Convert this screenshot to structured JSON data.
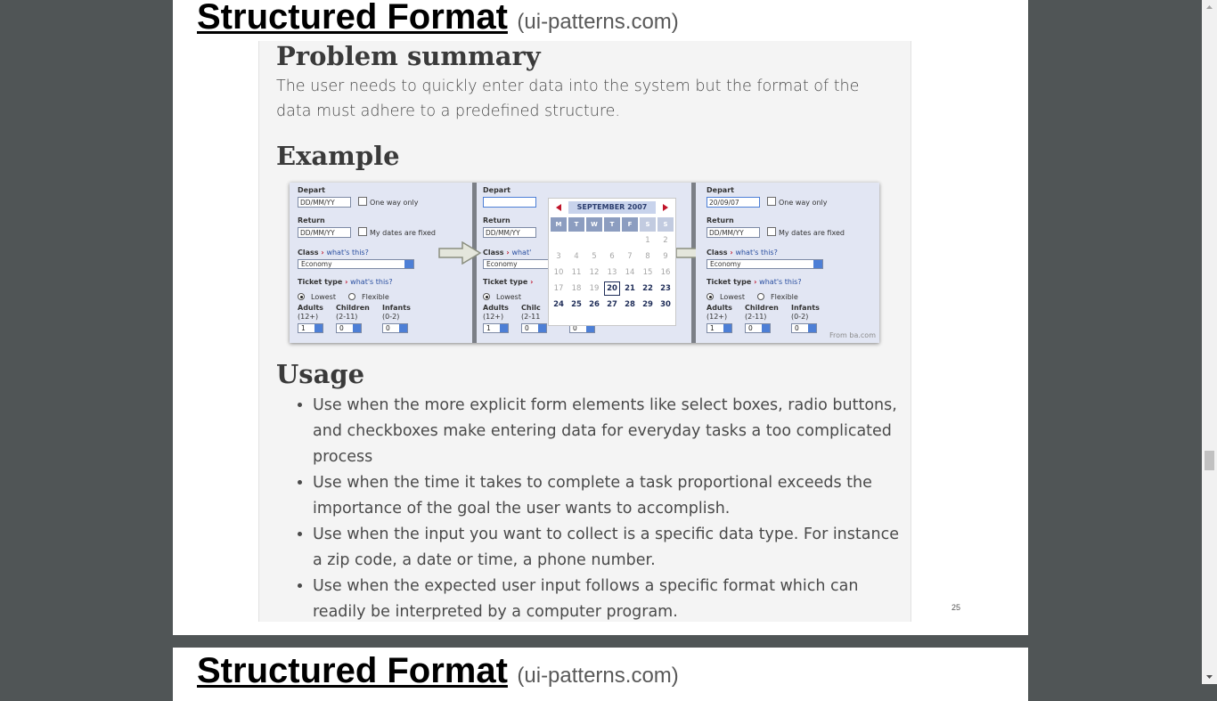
{
  "slide": {
    "title": "Structured Format",
    "source": "(ui-patterns.com)",
    "page_number": "25"
  },
  "next_slide": {
    "title": "Structured Format",
    "source": "(ui-patterns.com)"
  },
  "content": {
    "problem_heading": "Problem summary",
    "problem_text": "The user needs to quickly enter data into the system but the format of the data must adhere to a predefined structure.",
    "example_heading": "Example",
    "usage_heading": "Usage",
    "usage_items": [
      "Use when the more explicit form elements like select boxes, radio buttons, and checkboxes make entering data for everyday tasks a too complicated process",
      "Use when the time it takes to complete a task proportional exceeds the importance of the goal the user wants to accomplish.",
      "Use when the input you want to collect is a specific data type. For instance a zip code, a date or time, a phone number.",
      "Use when the expected user input follows a specific format which can readily be interpreted by a computer program."
    ]
  },
  "example_image": {
    "depart_label": "Depart",
    "return_label": "Return",
    "date_placeholder": "DD/MM/YY",
    "one_way": "One way only",
    "fixed_dates": "My dates are fixed",
    "class_label": "Class",
    "whats_this": "what's this?",
    "class_value": "Economy",
    "ticket_type_label": "Ticket type",
    "lowest": "Lowest",
    "flexible": "Flexible",
    "adults": "Adults",
    "adults_range": "(12+)",
    "children": "Children",
    "children_range": "(2-11)",
    "infants": "Infants",
    "infants_range": "(0-2)",
    "adults_value": "1",
    "children_value": "0",
    "infants_value": "0",
    "selected_date": "20/09/07",
    "cut_children": "Chilc",
    "cut_children_range": "(2-11",
    "cut_whats": "what'",
    "calendar_month": "SEPTEMBER 2007",
    "weekdays": [
      "M",
      "T",
      "W",
      "T",
      "F",
      "S",
      "S"
    ],
    "weeks": [
      [
        "",
        "",
        "",
        "",
        "",
        "1",
        "2"
      ],
      [
        "3",
        "4",
        "5",
        "6",
        "7",
        "8",
        "9"
      ],
      [
        "10",
        "11",
        "12",
        "13",
        "14",
        "15",
        "16"
      ],
      [
        "17",
        "18",
        "19",
        "20",
        "21",
        "22",
        "23"
      ],
      [
        "24",
        "25",
        "26",
        "27",
        "28",
        "29",
        "30"
      ],
      [
        "",
        "",
        "",
        "",
        "",
        "",
        ""
      ]
    ],
    "credit": "From ba.com"
  }
}
